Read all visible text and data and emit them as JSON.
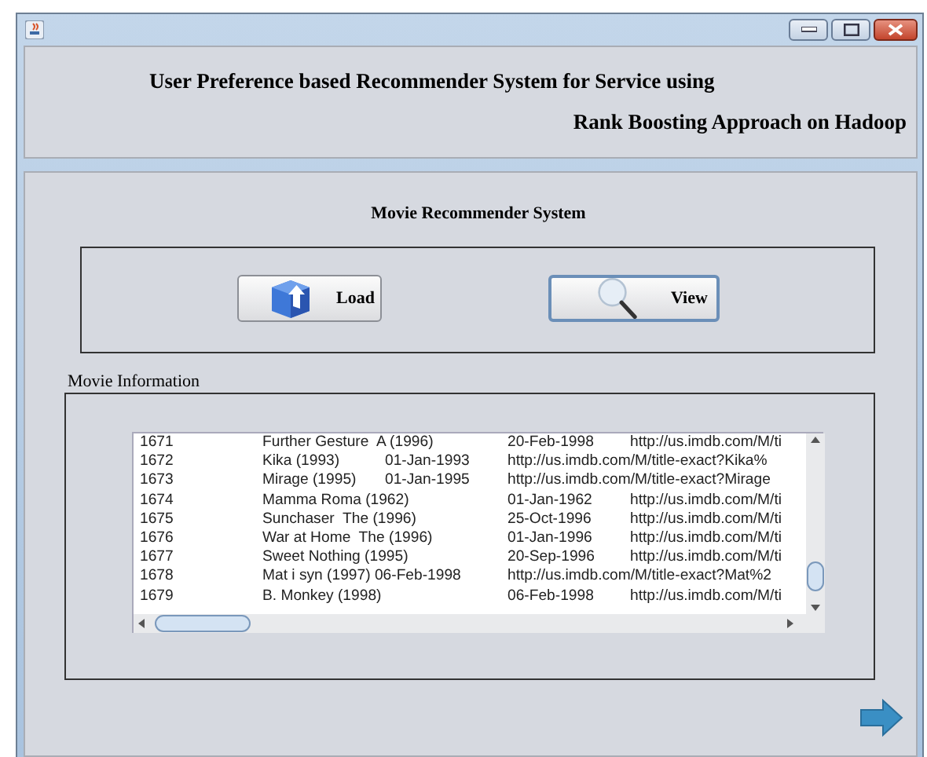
{
  "header": {
    "line_1": "User Preference based Recommender System for Service using",
    "line_2": "Rank Boosting Approach on Hadoop"
  },
  "section_title": "Movie Recommender System",
  "buttons": [
    {
      "label": "Load",
      "kind": "load"
    },
    {
      "label": "View",
      "kind": "view"
    }
  ],
  "movie_information": {
    "title": "Movie Information",
    "lines": [
      "1671\tFurther Gesture  A (1996)\t20-Feb-1998\thttp://us.imdb.com/M/ti",
      "1672\tKika (1993)\t01-Jan-1993\thttp://us.imdb.com/M/title-exact?Kika%",
      "1673\tMirage (1995)\t01-Jan-1995\thttp://us.imdb.com/M/title-exact?Mirage",
      "1674\tMamma Roma (1962)\t01-Jan-1962\thttp://us.imdb.com/M/ti",
      "1675\tSunchaser  The (1996)\t25-Oct-1996\thttp://us.imdb.com/M/ti",
      "1676\tWar at Home  The (1996)\t01-Jan-1996\thttp://us.imdb.com/M/ti",
      "1677\tSweet Nothing (1995)\t20-Sep-1996\thttp://us.imdb.com/M/ti",
      "1678\tMat i syn (1997) 06-Feb-1998\thttp://us.imdb.com/M/title-exact?Mat%2",
      "1679\tB. Monkey (1998)\t\t06-Feb-1998\thttp://us.imdb.com/M/ti"
    ]
  }
}
